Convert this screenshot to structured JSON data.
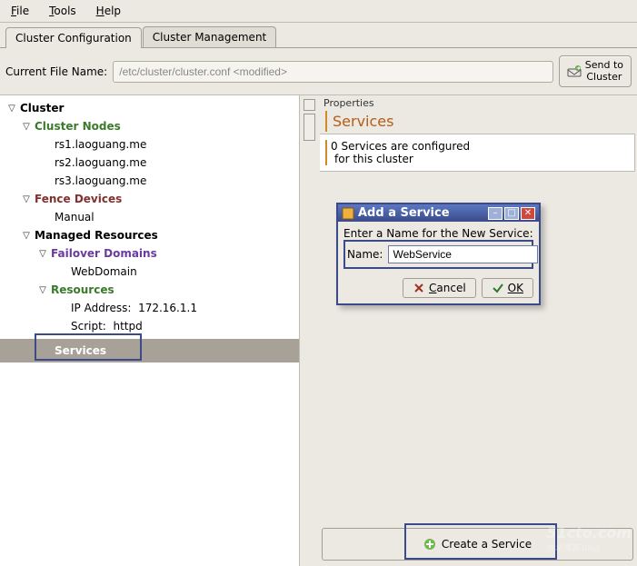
{
  "menubar": {
    "file": "File",
    "tools": "Tools",
    "help": "Help"
  },
  "tabs": {
    "config": "Cluster Configuration",
    "manage": "Cluster Management"
  },
  "filerow": {
    "label": "Current File Name:",
    "value": "/etc/cluster/cluster.conf <modified>",
    "send_line1": "Send to",
    "send_line2": "Cluster"
  },
  "tree": {
    "root": "Cluster",
    "nodes_hdr": "Cluster Nodes",
    "nodes": [
      "rs1.laoguang.me",
      "rs2.laoguang.me",
      "rs3.laoguang.me"
    ],
    "fence_hdr": "Fence Devices",
    "fence_items": [
      "Manual"
    ],
    "managed_hdr": "Managed Resources",
    "failover_hdr": "Failover Domains",
    "failover_items": [
      "WebDomain"
    ],
    "resources_hdr": "Resources",
    "res_ip_label": "IP Address:",
    "res_ip_value": "172.16.1.1",
    "res_script_label": "Script:",
    "res_script_value": "httpd",
    "services": "Services"
  },
  "props": {
    "title": "Properties",
    "heading": "Services",
    "line1": "0 Services are configured",
    "line2": "for this cluster"
  },
  "dialog": {
    "title": "Add a Service",
    "prompt": "Enter a Name for the New Service:",
    "name_label": "Name:",
    "name_value": "WebService",
    "cancel": "Cancel",
    "ok": "OK"
  },
  "create": {
    "label": "Create a Service"
  },
  "watermark": {
    "main": "51cto.com",
    "sub": "技术博客 Blog"
  }
}
